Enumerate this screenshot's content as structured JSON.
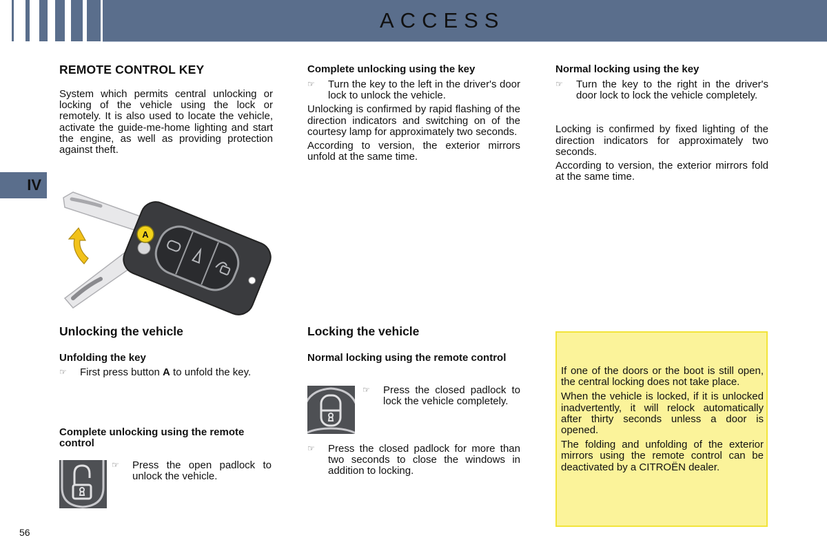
{
  "header": {
    "title": "ACCESS",
    "color": "#5a6e8c"
  },
  "chapter": {
    "label": "IV"
  },
  "page_number": "56",
  "col1": {
    "title": "REMOTE CONTROL KEY",
    "intro": "System which permits central unlocking or locking of the vehicle using the lock or remotely. It is also used to locate the vehicle, activate the guide-me-home lighting and start the engine, as well as providing protection against theft.",
    "illustration": {
      "button_label": "A",
      "icon": "folding-key-remote-illustration"
    },
    "unlocking_heading": "Unlocking the vehicle",
    "unfolding_heading": "Unfolding the key",
    "unfolding_bullet_pre": "First press button ",
    "unfolding_bullet_bold": "A",
    "unfolding_bullet_post": " to unfold the key.",
    "remote_unlock_heading": "Complete unlocking using the remote control",
    "remote_unlock_bullet": "Press the open padlock to unlock the vehicle.",
    "remote_unlock_icon": "open-padlock-button"
  },
  "col2": {
    "key_unlock_heading": "Complete unlocking using the key",
    "key_unlock_bullet": "Turn the key to the left in the driver's door lock to unlock the vehicle.",
    "key_unlock_p1": "Unlocking is confirmed by rapid flashing of the direction indicators and switching on of the courtesy lamp for approximately two seconds.",
    "key_unlock_p2": "According to version, the exterior mirrors unfold at the same time.",
    "locking_heading": "Locking the vehicle",
    "remote_lock_heading": "Normal locking using the remote control",
    "remote_lock_bullet": "Press the closed padlock to lock the vehicle completely.",
    "remote_lock_icon": "closed-padlock-button",
    "remote_lock_bullet2": "Press the closed padlock for more than two seconds to close the windows in addition to locking."
  },
  "col3": {
    "key_lock_heading": "Normal locking using the key",
    "key_lock_bullet": "Turn the key to the right in the driver's door lock to lock the vehicle completely.",
    "key_lock_p1": "Locking is confirmed by fixed lighting of the direction indicators for approximately two seconds.",
    "key_lock_p2": "According to version, the exterior mirrors fold at the same time.",
    "note": [
      "If one of the doors or the boot is still open, the central locking does not take place.",
      "When the vehicle is locked, if it is unlocked inadvertently, it will relock automatically after thirty seconds unless a door is opened.",
      "The folding and unfolding of the exterior mirrors using the remote control can be deactivated by a CITROËN dealer."
    ],
    "note_bg": "#fbf39a"
  },
  "bullet_glyph": "☞"
}
